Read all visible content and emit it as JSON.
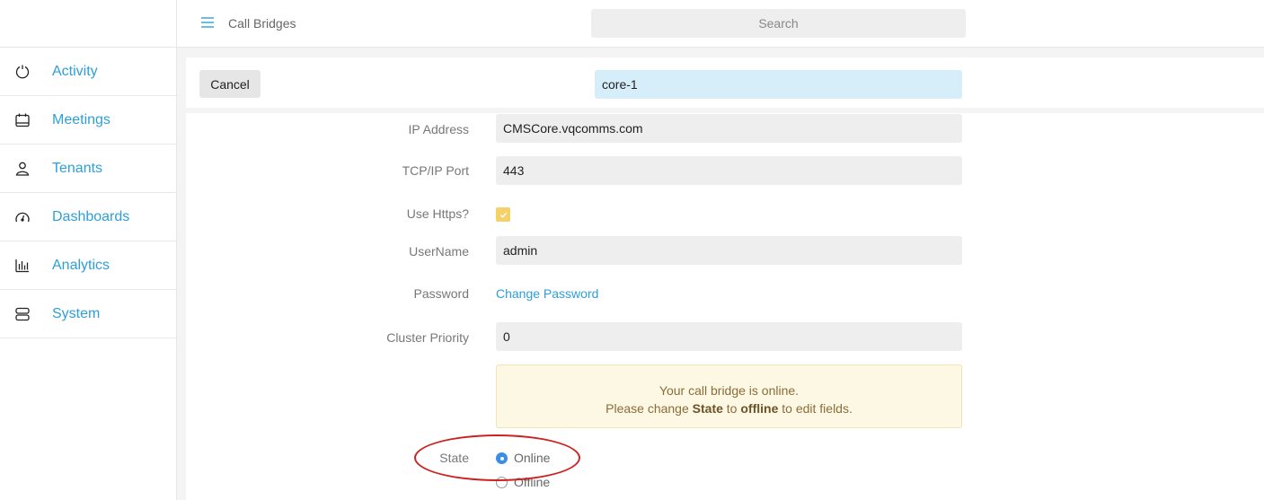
{
  "nav": {
    "items": [
      {
        "label": "Activity",
        "icon": "power-icon"
      },
      {
        "label": "Meetings",
        "icon": "calendar-icon"
      },
      {
        "label": "Tenants",
        "icon": "user-icon"
      },
      {
        "label": "Dashboards",
        "icon": "gauge-icon"
      },
      {
        "label": "Analytics",
        "icon": "bar-chart-icon"
      },
      {
        "label": "System",
        "icon": "server-icon"
      }
    ]
  },
  "topbar": {
    "breadcrumb": "Call Bridges",
    "search_placeholder": "Search"
  },
  "header": {
    "cancel_label": "Cancel",
    "name_value": "core-1"
  },
  "form": {
    "ip_label": "IP Address",
    "ip_value": "CMSCore.vqcomms.com",
    "port_label": "TCP/IP Port",
    "port_value": "443",
    "https_label": "Use Https?",
    "https_checked": true,
    "username_label": "UserName",
    "username_value": "admin",
    "password_label": "Password",
    "password_link": "Change Password",
    "priority_label": "Cluster Priority",
    "priority_value": "0",
    "notice_line1": "Your call bridge is online.",
    "notice_please": "Please change",
    "notice_state": "State",
    "notice_to": "to",
    "notice_offline": "offline",
    "notice_end": "to edit fields.",
    "state_label": "State",
    "state_online": "Online",
    "state_offline": "Offline",
    "state_selected": "Online"
  },
  "colors": {
    "accent": "#2d9fd9",
    "checkbox": "#f5d16c",
    "notice_bg": "#fcf8e3",
    "highlight": "#cc2222"
  }
}
